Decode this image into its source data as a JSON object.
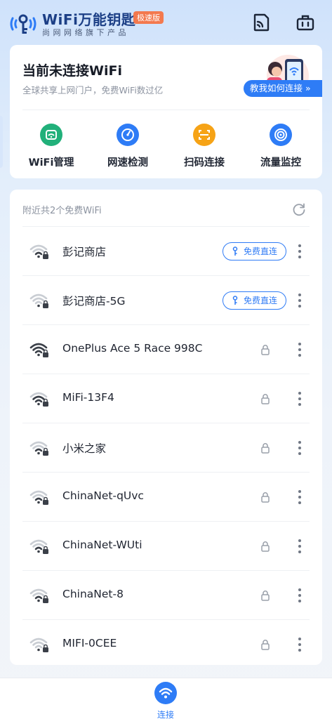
{
  "header": {
    "brand": "WiFi万能钥匙",
    "badge": "极速版",
    "subtitle": "尚网网络旗下产品",
    "icons": {
      "logo": "wifi-key-logo",
      "scan": "scan-icon",
      "toolbox": "toolbox-icon"
    }
  },
  "status": {
    "title": "当前未连接WiFi",
    "subtitle": "全球共享上网门户，免费WiFi数过亿",
    "teach_label": "教我如何连接 »"
  },
  "quick_actions": [
    {
      "label": "WiFi管理",
      "icon": "wifi-manage-icon",
      "color": "#21b07a"
    },
    {
      "label": "网速检测",
      "icon": "speedometer-icon",
      "color": "#2e7cf6"
    },
    {
      "label": "扫码连接",
      "icon": "scan-code-icon",
      "color": "#f6a316"
    },
    {
      "label": "流量监控",
      "icon": "traffic-monitor-icon",
      "color": "#2e7cf6"
    }
  ],
  "wifi_list": {
    "header": "附近共2个免费WiFi",
    "free_label": "免费直连",
    "items": [
      {
        "name": "彭记商店",
        "free": true,
        "signal": "2/4"
      },
      {
        "name": "彭记商店-5G",
        "free": true,
        "signal": "1/4"
      },
      {
        "name": "OnePlus Ace 5 Race 998C",
        "free": false,
        "signal": "4/4"
      },
      {
        "name": "MiFi-13F4",
        "free": false,
        "signal": "3/4"
      },
      {
        "name": "小米之家",
        "free": false,
        "signal": "2/4"
      },
      {
        "name": "ChinaNet-qUvc",
        "free": false,
        "signal": "2/4"
      },
      {
        "name": "ChinaNet-WUti",
        "free": false,
        "signal": "2/4"
      },
      {
        "name": "ChinaNet-8",
        "free": false,
        "signal": "2/4"
      },
      {
        "name": "MIFI-0CEE",
        "free": false,
        "signal": "1/4"
      }
    ]
  },
  "bottom_nav": {
    "label": "连接",
    "icon": "wifi-icon"
  },
  "colors": {
    "accent": "#2e7cf6",
    "brand": "#1c3f86",
    "badge": "#f3794e"
  }
}
